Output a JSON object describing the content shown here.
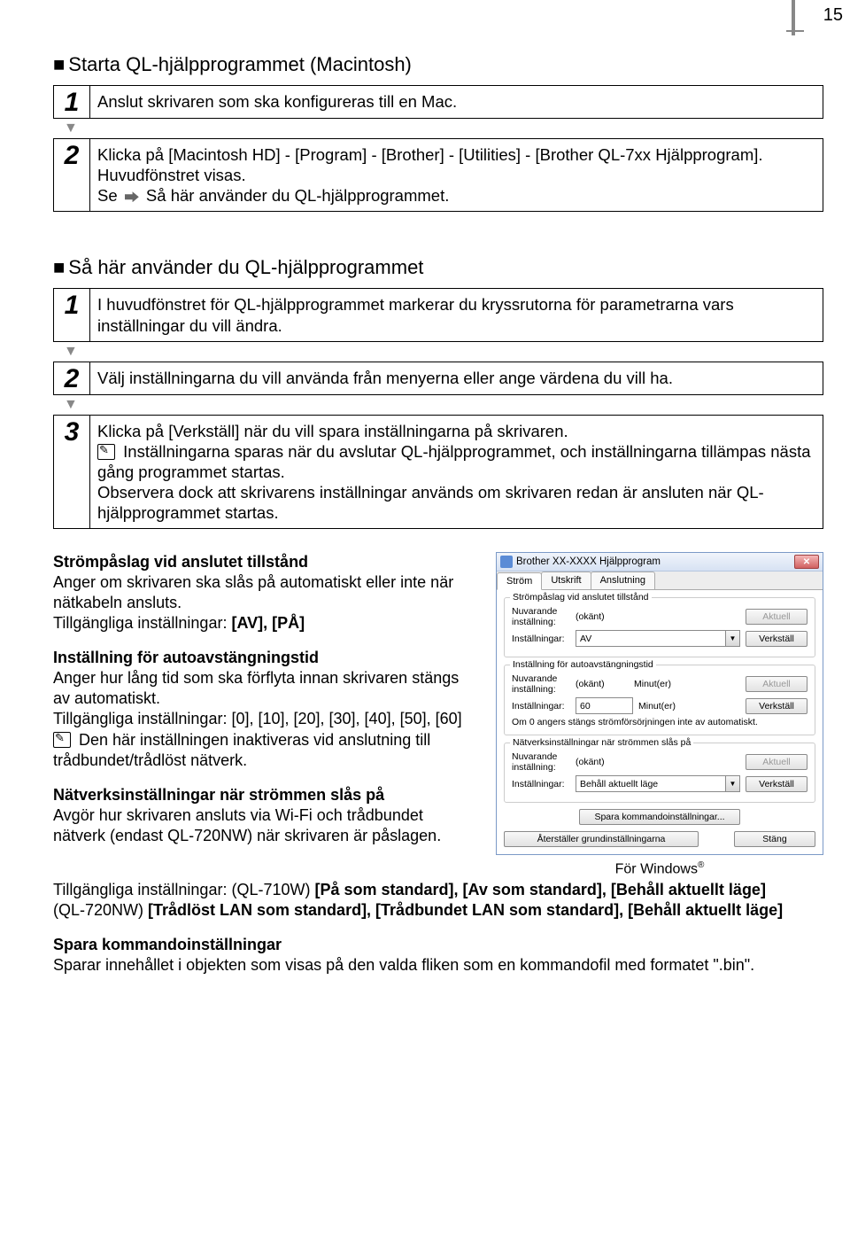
{
  "page_number": "15",
  "section1": {
    "title": "Starta QL-hjälpprogrammet (Macintosh)",
    "step1": "Anslut skrivaren som ska konfigureras till en Mac.",
    "step2_main": "Klicka på [Macintosh HD] - [Program] - [Brother] - [Utilities] - [Brother QL-7xx Hjälpprogram].",
    "step2_sub1": "Huvudfönstret visas.",
    "step2_sub2_pre": "Se",
    "step2_sub2_post": "Så här använder du QL-hjälpprogrammet."
  },
  "section2": {
    "title": "Så här använder du QL-hjälpprogrammet",
    "step1": "I huvudfönstret för QL-hjälpprogrammet markerar du kryssrutorna för parametrarna vars inställningar du vill ändra.",
    "step2": "Välj inställningarna du vill använda från menyerna eller ange värdena du vill ha.",
    "step3_main": "Klicka på [Verkställ] när du vill spara inställningarna på skrivaren.",
    "step3_note": "Inställningarna sparas när du avslutar QL-hjälpprogrammet, och inställningarna tillämpas nästa gång programmet startas.\nObservera dock att skrivarens inställningar används om skrivaren redan är ansluten när QL-hjälpprogrammet startas."
  },
  "settings": {
    "strom": {
      "heading": "Strömpåslag vid anslutet tillstånd",
      "body": "Anger om skrivaren ska slås på automatiskt eller inte när nätkabeln ansluts.",
      "avail_label": "Tillgängliga inställningar:",
      "opts": "[AV], [PÅ]"
    },
    "auto": {
      "heading": "Inställning för autoavstängningstid",
      "body": "Anger hur lång tid som ska förflyta innan skrivaren stängs av automatiskt.",
      "avail_label": "Tillgängliga inställningar:",
      "opts": "[0], [10], [20], [30], [40], [50], [60]",
      "note": "Den här inställningen inaktiveras vid anslutning till trådbundet/trådlöst nätverk."
    },
    "natverk": {
      "heading": "Nätverksinställningar när strömmen slås på",
      "body": "Avgör hur skrivaren ansluts via Wi-Fi och trådbundet nätverk (endast QL-720NW) när skrivaren är påslagen.",
      "avail_label": "Tillgängliga inställningar:",
      "line1_pre": "(QL-710W)",
      "line1_opts": "[På som standard], [Av som standard], [Behåll aktuellt läge]",
      "line2_pre": "(QL-720NW)",
      "line2_opts": "[Trådlöst LAN som standard], [Trådbundet LAN som standard], [Behåll aktuellt läge]"
    },
    "spara": {
      "heading": "Spara kommandoinställningar",
      "body": "Sparar innehållet i objekten som visas på den valda fliken som en kommandofil med formatet \".bin\"."
    }
  },
  "screenshot": {
    "title": "Brother XX-XXXX  Hjälpprogram",
    "tabs": [
      "Ström",
      "Utskrift",
      "Anslutning"
    ],
    "group1": {
      "legend": "Strömpåslag vid anslutet tillstånd",
      "current_lbl": "Nuvarande inställning:",
      "current_val": "(okänt)",
      "setting_lbl": "Inställningar:",
      "dd_val": "AV",
      "btn_current": "Aktuell",
      "btn_apply": "Verkställ"
    },
    "group2": {
      "legend": "Inställning för autoavstängningstid",
      "current_lbl": "Nuvarande inställning:",
      "current_val": "(okänt)",
      "unit1": "Minut(er)",
      "setting_lbl": "Inställningar:",
      "input_val": "60",
      "unit2": "Minut(er)",
      "hint": "Om 0 angers stängs strömförsörjningen inte av automatiskt.",
      "btn_current": "Aktuell",
      "btn_apply": "Verkställ"
    },
    "group3": {
      "legend": "Nätverksinställningar när strömmen slås på",
      "current_lbl": "Nuvarande inställning:",
      "current_val": "(okänt)",
      "setting_lbl": "Inställningar:",
      "dd_val": "Behåll aktuellt läge",
      "btn_current": "Aktuell",
      "btn_apply": "Verkställ"
    },
    "save_cmd": "Spara kommandoinställningar...",
    "restore": "Återställer grundinställningarna",
    "close": "Stäng",
    "caption_pre": "För Windows",
    "caption_sup": "®"
  }
}
